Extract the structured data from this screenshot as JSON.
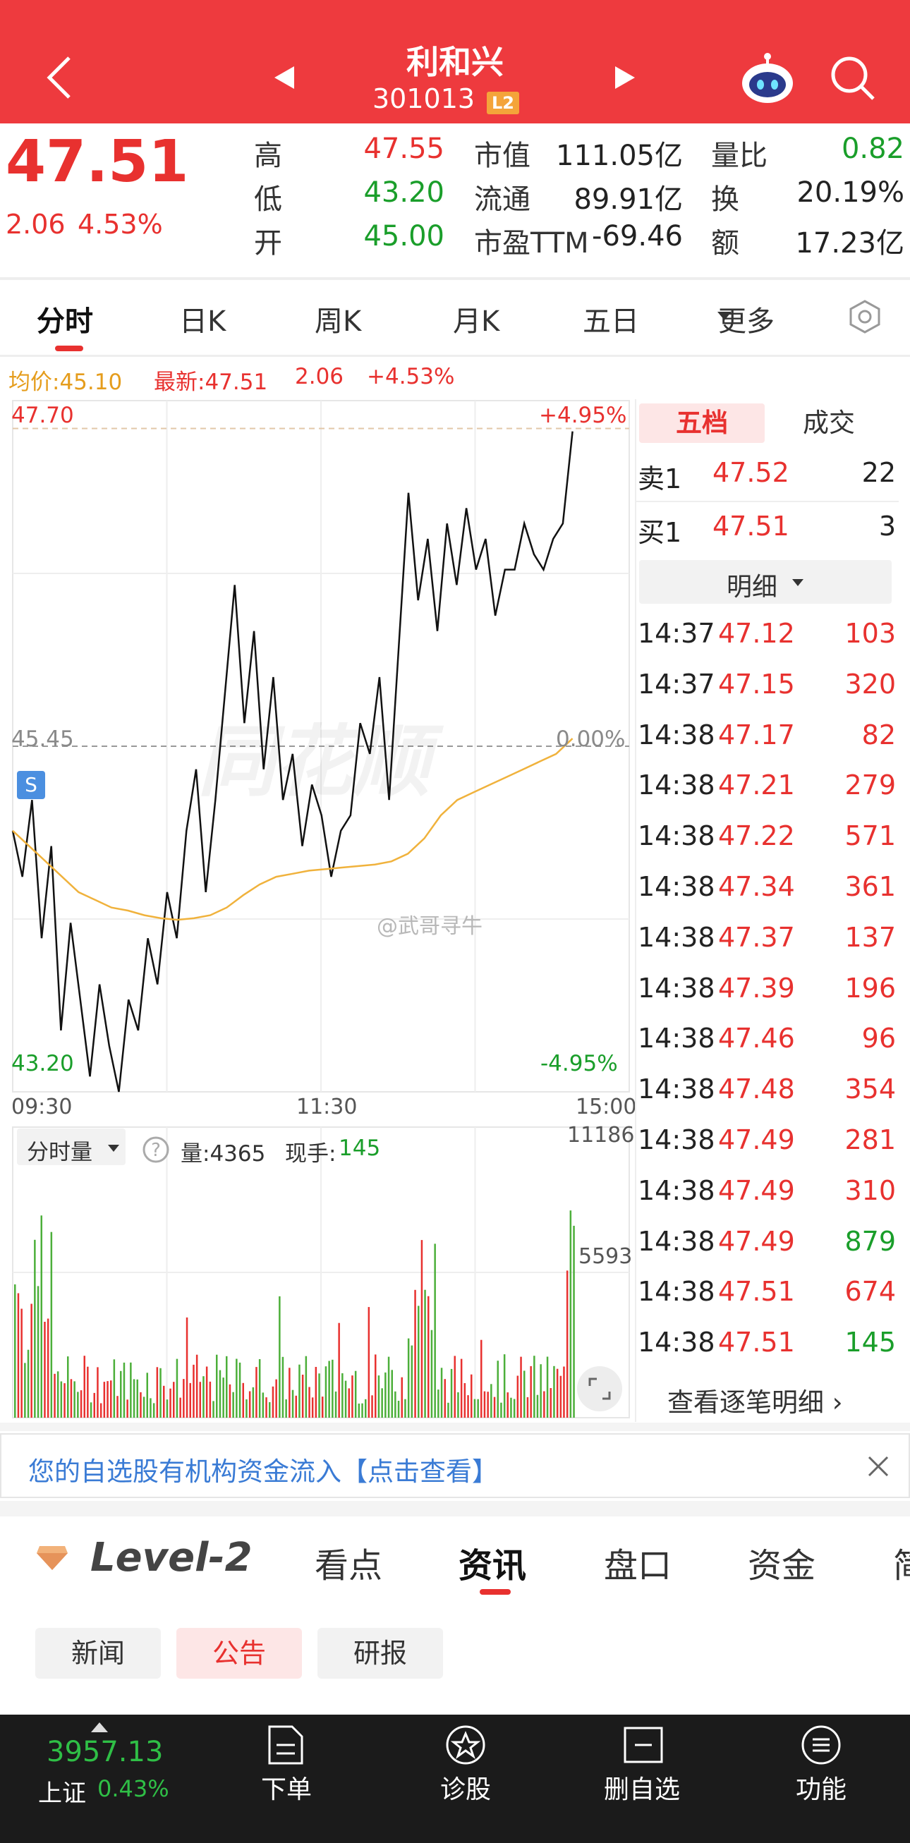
{
  "header": {
    "title": "利和兴",
    "code": "301013",
    "badge": "L2"
  },
  "quote": {
    "price": "47.51",
    "change": "2.06",
    "change_pct": "4.53%",
    "stats": [
      {
        "label": "高",
        "value": "47.55",
        "color": "red"
      },
      {
        "label": "低",
        "value": "43.20",
        "color": "green"
      },
      {
        "label": "开",
        "value": "45.00",
        "color": "green"
      },
      {
        "label": "市值",
        "value": "111.05亿",
        "color": "black"
      },
      {
        "label": "流通",
        "value": "89.91亿",
        "color": "black"
      },
      {
        "label": "市盈TTM",
        "value": "-69.46",
        "color": "black"
      },
      {
        "label": "量比",
        "value": "0.82",
        "color": "green"
      },
      {
        "label": "换",
        "value": "20.19%",
        "color": "black"
      },
      {
        "label": "额",
        "value": "17.23亿",
        "color": "black"
      }
    ]
  },
  "tabs": [
    "分时",
    "日K",
    "周K",
    "月K",
    "五日",
    "更多"
  ],
  "chart_info": {
    "avg": "均价:45.10",
    "latest": "最新:47.51",
    "chg": "2.06",
    "chg_pct": "+4.53%"
  },
  "chart_data": {
    "type": "line",
    "price_axis": {
      "top": "47.70",
      "mid": "45.45",
      "bottom": "43.20",
      "top_pct": "+4.95%",
      "mid_pct": "0.00%",
      "bottom_pct": "-4.95%"
    },
    "ylim": [
      43.2,
      47.7
    ],
    "x_ticks": [
      "09:30",
      "11:30",
      "15:00"
    ],
    "price_series": [
      44.9,
      44.6,
      45.1,
      44.2,
      44.8,
      43.6,
      44.3,
      43.8,
      43.3,
      43.9,
      43.5,
      43.2,
      43.8,
      43.6,
      44.2,
      43.9,
      44.5,
      44.2,
      44.9,
      45.3,
      44.5,
      45.1,
      45.8,
      46.5,
      45.6,
      46.2,
      45.3,
      45.9,
      45.1,
      45.4,
      44.8,
      45.2,
      45.0,
      44.6,
      44.9,
      45.0,
      45.6,
      45.4,
      45.9,
      45.1,
      46.1,
      47.1,
      46.4,
      46.8,
      46.2,
      46.9,
      46.5,
      47.0,
      46.6,
      46.8,
      46.3,
      46.6,
      46.6,
      46.9,
      46.7,
      46.6,
      46.8,
      46.9,
      47.5
    ],
    "avg_series": [
      44.9,
      44.8,
      44.7,
      44.6,
      44.5,
      44.45,
      44.4,
      44.38,
      44.35,
      44.33,
      44.32,
      44.33,
      44.35,
      44.4,
      44.48,
      44.55,
      44.6,
      44.62,
      44.64,
      44.65,
      44.66,
      44.67,
      44.68,
      44.7,
      44.75,
      44.85,
      45.0,
      45.1,
      45.15,
      45.2,
      45.25,
      45.3,
      45.35,
      45.4,
      45.5
    ],
    "volume_axis": {
      "max": "11186",
      "mid": "5593"
    },
    "volume_info": {
      "selector": "分时量",
      "amount": "量:4365",
      "current_label": "现手:",
      "current_value": "145"
    }
  },
  "panel": {
    "tabs": [
      "五档",
      "成交"
    ],
    "sell": {
      "label": "卖1",
      "price": "47.52",
      "vol": "22"
    },
    "buy": {
      "label": "买1",
      "price": "47.51",
      "vol": "3"
    },
    "detail_label": "明细",
    "ticks": [
      {
        "time": "14:37",
        "price": "47.12",
        "vol": "103",
        "color": "red"
      },
      {
        "time": "14:37",
        "price": "47.15",
        "vol": "320",
        "color": "red"
      },
      {
        "time": "14:38",
        "price": "47.17",
        "vol": "82",
        "color": "red"
      },
      {
        "time": "14:38",
        "price": "47.21",
        "vol": "279",
        "color": "red"
      },
      {
        "time": "14:38",
        "price": "47.22",
        "vol": "571",
        "color": "red"
      },
      {
        "time": "14:38",
        "price": "47.34",
        "vol": "361",
        "color": "red"
      },
      {
        "time": "14:38",
        "price": "47.37",
        "vol": "137",
        "color": "red"
      },
      {
        "time": "14:38",
        "price": "47.39",
        "vol": "196",
        "color": "red"
      },
      {
        "time": "14:38",
        "price": "47.46",
        "vol": "96",
        "color": "red"
      },
      {
        "time": "14:38",
        "price": "47.48",
        "vol": "354",
        "color": "red"
      },
      {
        "time": "14:38",
        "price": "47.49",
        "vol": "281",
        "color": "red"
      },
      {
        "time": "14:38",
        "price": "47.49",
        "vol": "310",
        "color": "red"
      },
      {
        "time": "14:38",
        "price": "47.49",
        "vol": "879",
        "color": "green"
      },
      {
        "time": "14:38",
        "price": "47.51",
        "vol": "674",
        "color": "red"
      },
      {
        "time": "14:38",
        "price": "47.51",
        "vol": "145",
        "color": "green"
      }
    ],
    "view_all": "查看逐笔明细 ›"
  },
  "watermarks": {
    "brand": "同花顺",
    "weibo": "@武哥寻牛"
  },
  "banner": {
    "text": "您的自选股有机构资金流入【点击查看】"
  },
  "section_tabs": [
    "Level-2",
    "看点",
    "资讯",
    "盘口",
    "资金",
    "简"
  ],
  "sub_tabs": [
    "新闻",
    "公告",
    "研报"
  ],
  "bottom_nav": {
    "index_value": "3957.13",
    "index_name": "上证",
    "index_pct": "0.43%",
    "items": [
      {
        "label": "下单",
        "icon": "order-icon"
      },
      {
        "label": "诊股",
        "icon": "diagnose-icon"
      },
      {
        "label": "删自选",
        "icon": "remove-watch-icon"
      },
      {
        "label": "功能",
        "icon": "menu-icon"
      }
    ]
  }
}
